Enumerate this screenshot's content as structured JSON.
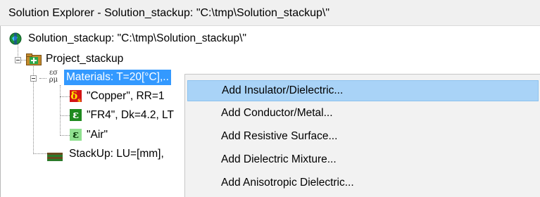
{
  "window": {
    "title": "Solution Explorer - Solution_stackup: \"C:\\tmp\\Solution_stackup\\\""
  },
  "tree": {
    "root_label": "Solution_stackup: \"C:\\tmp\\Solution_stackup\\\"",
    "project_label": "Project_stackup",
    "materials_label": "Materials: T=20[°C],..",
    "materials_icon_text": "εσ\nρμ",
    "copper_label": "\"Copper\", RR=1",
    "copper_icon_text": "δs",
    "fr4_label": "\"FR4\", Dk=4.2, LT",
    "fr4_icon_text": "ε",
    "air_label": "\"Air\"",
    "air_icon_text": "ε",
    "stackup_label": "StackUp: LU=[mm],",
    "colors": {
      "selection": "#3399ff",
      "copper_icon_bg": "#d41414",
      "copper_icon_fg": "#ffe100",
      "fr4_icon_bg": "#1f8a1f",
      "air_icon_bg": "#8fe08f"
    }
  },
  "context_menu": {
    "items": [
      {
        "label": "Add Insulator/Dielectric...",
        "highlighted": true
      },
      {
        "label": "Add Conductor/Metal...",
        "highlighted": false
      },
      {
        "label": "Add Resistive Surface...",
        "highlighted": false
      },
      {
        "label": "Add Dielectric Mixture...",
        "highlighted": false
      },
      {
        "label": "Add Anisotropic Dielectric...",
        "highlighted": false
      }
    ]
  }
}
